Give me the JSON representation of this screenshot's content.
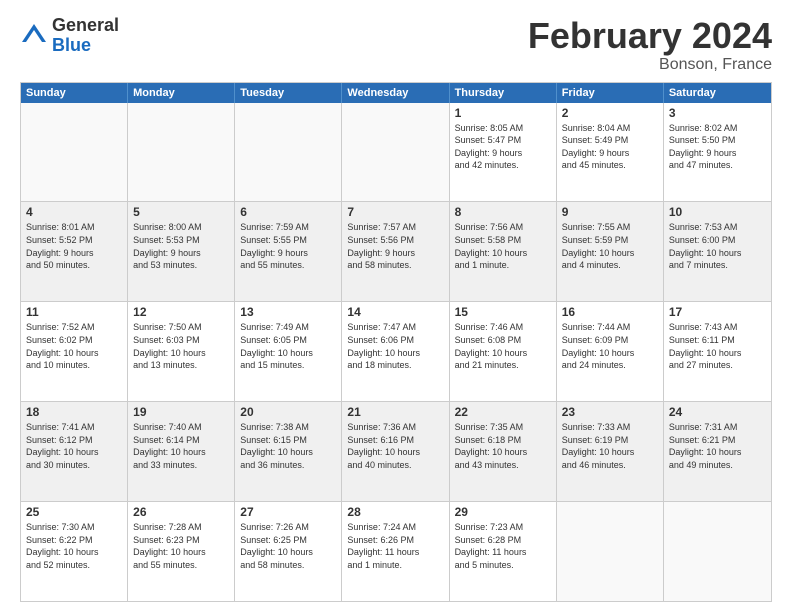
{
  "logo": {
    "general": "General",
    "blue": "Blue"
  },
  "header": {
    "month": "February 2024",
    "location": "Bonson, France"
  },
  "weekdays": [
    "Sunday",
    "Monday",
    "Tuesday",
    "Wednesday",
    "Thursday",
    "Friday",
    "Saturday"
  ],
  "rows": [
    [
      {
        "day": "",
        "info": "",
        "empty": true
      },
      {
        "day": "",
        "info": "",
        "empty": true
      },
      {
        "day": "",
        "info": "",
        "empty": true
      },
      {
        "day": "",
        "info": "",
        "empty": true
      },
      {
        "day": "1",
        "info": "Sunrise: 8:05 AM\nSunset: 5:47 PM\nDaylight: 9 hours\nand 42 minutes."
      },
      {
        "day": "2",
        "info": "Sunrise: 8:04 AM\nSunset: 5:49 PM\nDaylight: 9 hours\nand 45 minutes."
      },
      {
        "day": "3",
        "info": "Sunrise: 8:02 AM\nSunset: 5:50 PM\nDaylight: 9 hours\nand 47 minutes."
      }
    ],
    [
      {
        "day": "4",
        "info": "Sunrise: 8:01 AM\nSunset: 5:52 PM\nDaylight: 9 hours\nand 50 minutes."
      },
      {
        "day": "5",
        "info": "Sunrise: 8:00 AM\nSunset: 5:53 PM\nDaylight: 9 hours\nand 53 minutes."
      },
      {
        "day": "6",
        "info": "Sunrise: 7:59 AM\nSunset: 5:55 PM\nDaylight: 9 hours\nand 55 minutes."
      },
      {
        "day": "7",
        "info": "Sunrise: 7:57 AM\nSunset: 5:56 PM\nDaylight: 9 hours\nand 58 minutes."
      },
      {
        "day": "8",
        "info": "Sunrise: 7:56 AM\nSunset: 5:58 PM\nDaylight: 10 hours\nand 1 minute."
      },
      {
        "day": "9",
        "info": "Sunrise: 7:55 AM\nSunset: 5:59 PM\nDaylight: 10 hours\nand 4 minutes."
      },
      {
        "day": "10",
        "info": "Sunrise: 7:53 AM\nSunset: 6:00 PM\nDaylight: 10 hours\nand 7 minutes."
      }
    ],
    [
      {
        "day": "11",
        "info": "Sunrise: 7:52 AM\nSunset: 6:02 PM\nDaylight: 10 hours\nand 10 minutes."
      },
      {
        "day": "12",
        "info": "Sunrise: 7:50 AM\nSunset: 6:03 PM\nDaylight: 10 hours\nand 13 minutes."
      },
      {
        "day": "13",
        "info": "Sunrise: 7:49 AM\nSunset: 6:05 PM\nDaylight: 10 hours\nand 15 minutes."
      },
      {
        "day": "14",
        "info": "Sunrise: 7:47 AM\nSunset: 6:06 PM\nDaylight: 10 hours\nand 18 minutes."
      },
      {
        "day": "15",
        "info": "Sunrise: 7:46 AM\nSunset: 6:08 PM\nDaylight: 10 hours\nand 21 minutes."
      },
      {
        "day": "16",
        "info": "Sunrise: 7:44 AM\nSunset: 6:09 PM\nDaylight: 10 hours\nand 24 minutes."
      },
      {
        "day": "17",
        "info": "Sunrise: 7:43 AM\nSunset: 6:11 PM\nDaylight: 10 hours\nand 27 minutes."
      }
    ],
    [
      {
        "day": "18",
        "info": "Sunrise: 7:41 AM\nSunset: 6:12 PM\nDaylight: 10 hours\nand 30 minutes."
      },
      {
        "day": "19",
        "info": "Sunrise: 7:40 AM\nSunset: 6:14 PM\nDaylight: 10 hours\nand 33 minutes."
      },
      {
        "day": "20",
        "info": "Sunrise: 7:38 AM\nSunset: 6:15 PM\nDaylight: 10 hours\nand 36 minutes."
      },
      {
        "day": "21",
        "info": "Sunrise: 7:36 AM\nSunset: 6:16 PM\nDaylight: 10 hours\nand 40 minutes."
      },
      {
        "day": "22",
        "info": "Sunrise: 7:35 AM\nSunset: 6:18 PM\nDaylight: 10 hours\nand 43 minutes."
      },
      {
        "day": "23",
        "info": "Sunrise: 7:33 AM\nSunset: 6:19 PM\nDaylight: 10 hours\nand 46 minutes."
      },
      {
        "day": "24",
        "info": "Sunrise: 7:31 AM\nSunset: 6:21 PM\nDaylight: 10 hours\nand 49 minutes."
      }
    ],
    [
      {
        "day": "25",
        "info": "Sunrise: 7:30 AM\nSunset: 6:22 PM\nDaylight: 10 hours\nand 52 minutes."
      },
      {
        "day": "26",
        "info": "Sunrise: 7:28 AM\nSunset: 6:23 PM\nDaylight: 10 hours\nand 55 minutes."
      },
      {
        "day": "27",
        "info": "Sunrise: 7:26 AM\nSunset: 6:25 PM\nDaylight: 10 hours\nand 58 minutes."
      },
      {
        "day": "28",
        "info": "Sunrise: 7:24 AM\nSunset: 6:26 PM\nDaylight: 11 hours\nand 1 minute."
      },
      {
        "day": "29",
        "info": "Sunrise: 7:23 AM\nSunset: 6:28 PM\nDaylight: 11 hours\nand 5 minutes."
      },
      {
        "day": "",
        "info": "",
        "empty": true
      },
      {
        "day": "",
        "info": "",
        "empty": true
      }
    ]
  ]
}
